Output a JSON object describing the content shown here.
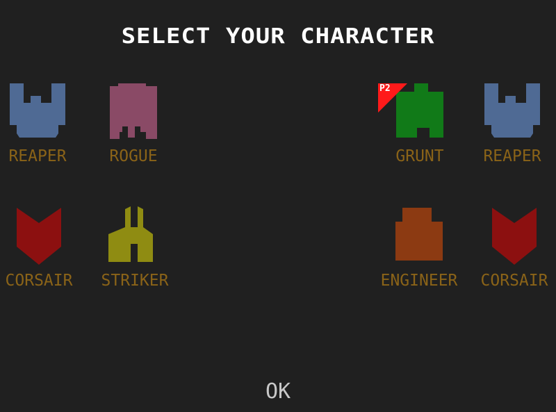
{
  "screen": {
    "title": "SELECT YOUR CHARACTER",
    "ok_label": "OK"
  },
  "player1_characters": [
    {
      "label": "REAPER",
      "color": "#4f6a94",
      "shape": "reaper"
    },
    {
      "label": "ROGUE",
      "color": "#8a4a66",
      "shape": "rogue"
    },
    {
      "label": "CORSAIR",
      "color": "#8c1010",
      "shape": "corsair"
    },
    {
      "label": "STRIKER",
      "color": "#8f8c12",
      "shape": "striker"
    }
  ],
  "player2_characters": [
    {
      "label": "GRUNT",
      "color": "#117a18",
      "shape": "grunt"
    },
    {
      "label": "REAPER",
      "color": "#4f6a94",
      "shape": "reaper"
    },
    {
      "label": "ENGINEER",
      "color": "#8c3a12",
      "shape": "engineer"
    },
    {
      "label": "CORSAIR",
      "color": "#8c1010",
      "shape": "corsair"
    }
  ],
  "player2_badge": {
    "text": "P2",
    "color": "#ff1a1a",
    "selected_character": "GRUNT"
  },
  "label_color": "#8a6318"
}
